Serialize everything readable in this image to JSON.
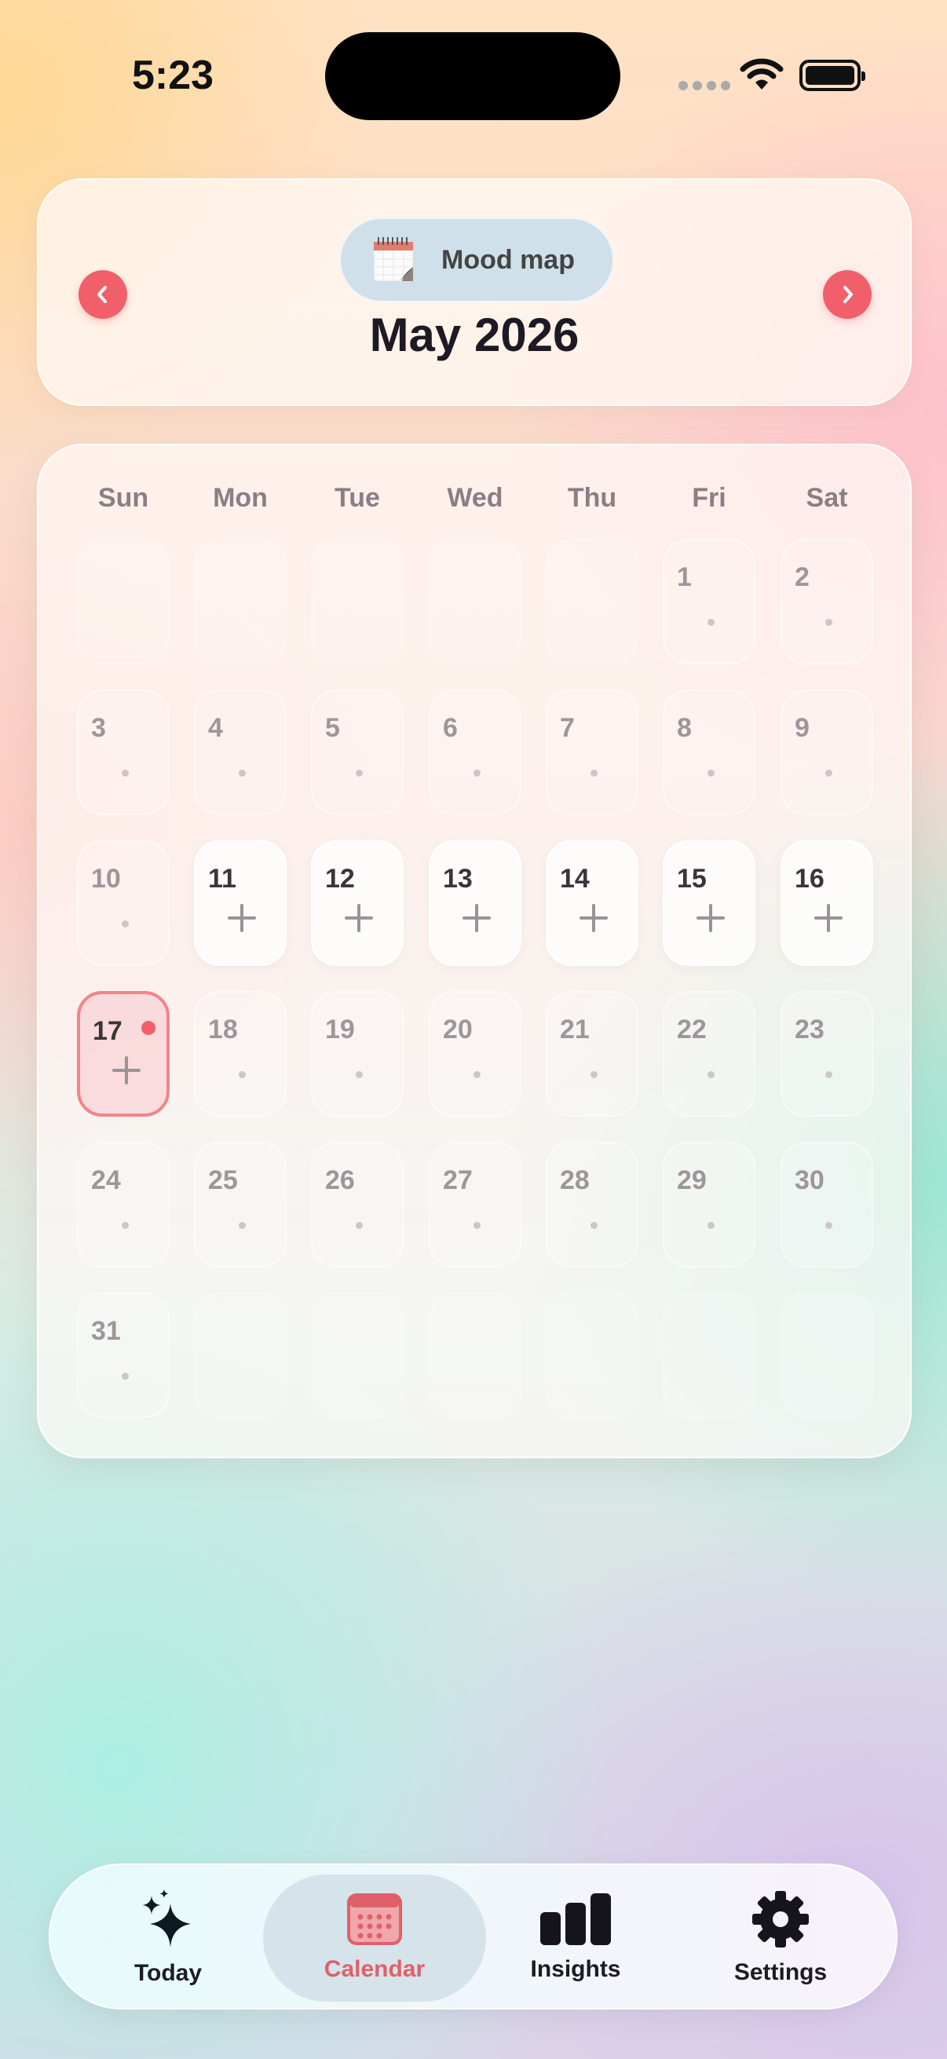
{
  "status_bar": {
    "time": "5:23"
  },
  "header": {
    "badge_label": "Mood map",
    "month_title": "May 2026",
    "prev_icon": "chevron-left-icon",
    "next_icon": "chevron-right-icon",
    "badge_icon": "notepad-emoji-icon",
    "accent_color": "#f1606a"
  },
  "calendar": {
    "weekdays": [
      "Sun",
      "Mon",
      "Tue",
      "Wed",
      "Thu",
      "Fri",
      "Sat"
    ],
    "today": "17",
    "weeks": [
      [
        null,
        null,
        null,
        null,
        null,
        "1",
        "2"
      ],
      [
        "3",
        "4",
        "5",
        "6",
        "7",
        "8",
        "9"
      ],
      [
        "10",
        "11",
        "12",
        "13",
        "14",
        "15",
        "16"
      ],
      [
        "17",
        "18",
        "19",
        "20",
        "21",
        "22",
        "23"
      ],
      [
        "24",
        "25",
        "26",
        "27",
        "28",
        "29",
        "30"
      ],
      [
        "31",
        null,
        null,
        null,
        null,
        null,
        null
      ]
    ],
    "loggable_days": [
      "11",
      "12",
      "13",
      "14",
      "15",
      "16",
      "17"
    ]
  },
  "tabbar": {
    "selected": "Calendar",
    "tabs": [
      {
        "label": "Today",
        "icon": "sparkles-icon"
      },
      {
        "label": "Calendar",
        "icon": "calendar-icon"
      },
      {
        "label": "Insights",
        "icon": "bar-chart-icon"
      },
      {
        "label": "Settings",
        "icon": "gear-icon"
      }
    ]
  }
}
